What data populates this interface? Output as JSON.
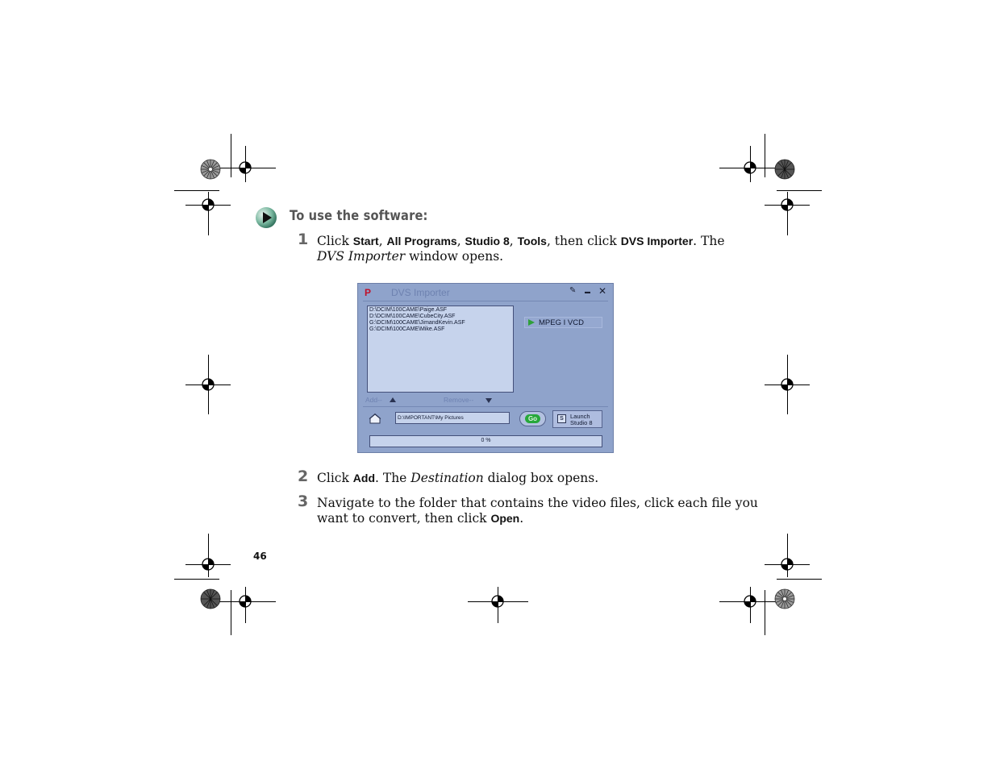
{
  "section": {
    "title": "To use the software:"
  },
  "steps": [
    {
      "number": "1",
      "parts": [
        "Click ",
        "Start",
        ", ",
        "All Programs",
        ", ",
        "Studio 8",
        ", ",
        "Tools",
        ", then click ",
        "DVS Importer",
        ". The"
      ],
      "line2_italic": "DVS Importer",
      "line2_rest": " window opens."
    },
    {
      "number": "2",
      "pre": "Click ",
      "kw": "Add",
      "mid": ". The ",
      "italic": "Destination",
      "post": " dialog box opens."
    },
    {
      "number": "3",
      "line1": "Navigate to the folder that contains the video files, click each file you",
      "line2_pre": "want to convert, then click ",
      "line2_kw": "Open",
      "line2_post": "."
    }
  ],
  "dialog": {
    "logo": "P",
    "title": "DVS Importer",
    "pin": "✎",
    "minimize": "▬",
    "close": "✕",
    "files": [
      "D:\\DCIM\\100CAME\\Paige.ASF",
      "D:\\DCIM\\100CAME\\CubeCity.ASF",
      "G:\\DCIM\\100CAME\\JimandKevin.ASF",
      "G:\\DCIM\\100CAME\\Mike.ASF"
    ],
    "format_label": "MPEG I VCD",
    "add_label": "Add--",
    "remove_label": "Remove--",
    "destination": "D:\\IMPORTANT\\My Pictures",
    "go_label": "Go",
    "launch_line1": "Launch",
    "launch_line2": "Studio 8",
    "launch_icon": "S",
    "progress_text": "0 %",
    "progress_value": 0
  },
  "page_number": "46"
}
